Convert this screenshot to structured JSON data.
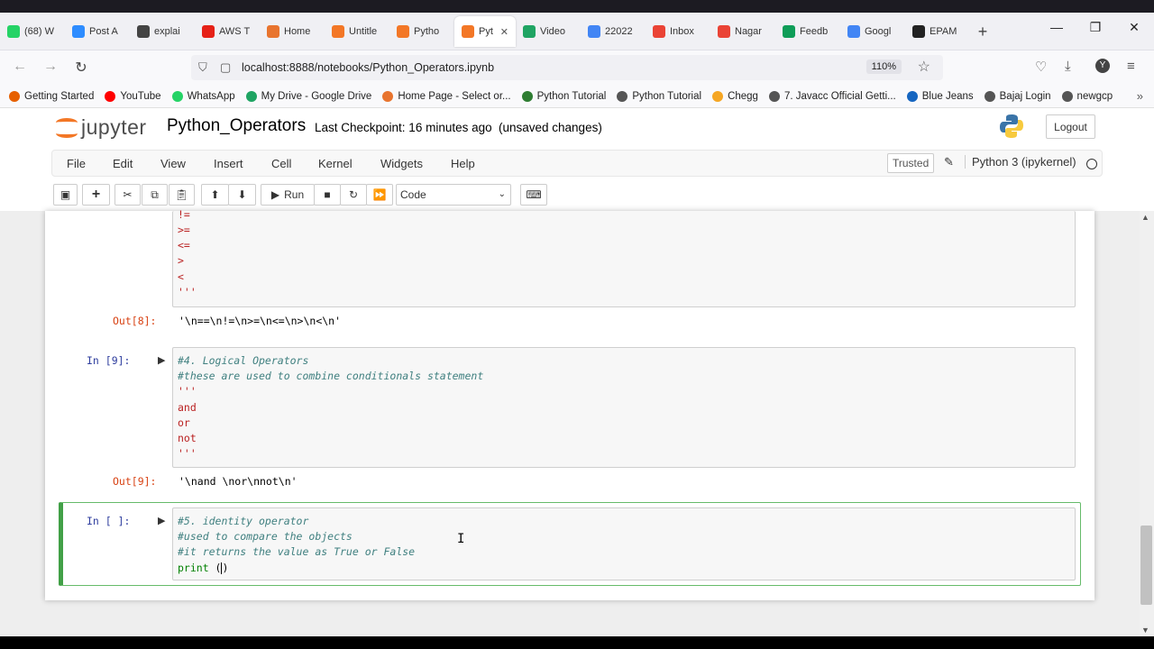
{
  "browser": {
    "tabs": [
      {
        "label": "(68) W",
        "color": "#25d366"
      },
      {
        "label": "Post A",
        "color": "#2d8cff"
      },
      {
        "label": "explai",
        "color": "#444444"
      },
      {
        "label": "AWS T",
        "color": "#e62117"
      },
      {
        "label": "Home",
        "color": "#e8742e"
      },
      {
        "label": "Untitle",
        "color": "#f37726"
      },
      {
        "label": "Pytho",
        "color": "#f37726"
      },
      {
        "label": "Pyt",
        "color": "#f37726",
        "active": true
      },
      {
        "label": "Video",
        "color": "#1fa463"
      },
      {
        "label": "22022",
        "color": "#4285f4"
      },
      {
        "label": "Inbox",
        "color": "#ea4335"
      },
      {
        "label": "Nagar",
        "color": "#ea4335"
      },
      {
        "label": "Feedb",
        "color": "#0f9d58"
      },
      {
        "label": "Googl",
        "color": "#4285f4"
      },
      {
        "label": "EPAM",
        "color": "#222222"
      }
    ],
    "url": "localhost:8888/notebooks/Python_Operators.ipynb",
    "zoom": "110%",
    "bookmarks": [
      {
        "label": "Getting Started",
        "color": "#e66000"
      },
      {
        "label": "YouTube",
        "color": "#ff0000"
      },
      {
        "label": "WhatsApp",
        "color": "#25d366"
      },
      {
        "label": "My Drive - Google Drive",
        "color": "#1fa463"
      },
      {
        "label": "Home Page - Select or...",
        "color": "#e8742e"
      },
      {
        "label": "Python Tutorial",
        "color": "#2e7d32"
      },
      {
        "label": "Python Tutorial",
        "color": "#555555"
      },
      {
        "label": "Chegg",
        "color": "#f5a623"
      },
      {
        "label": "7. Javacc Official Getti...",
        "color": "#555555"
      },
      {
        "label": "Blue Jeans",
        "color": "#1565c0"
      },
      {
        "label": "Bajaj Login",
        "color": "#555555"
      },
      {
        "label": "newgcp",
        "color": "#555555"
      }
    ]
  },
  "jupyter": {
    "logo_text": "jupyter",
    "notebook_title": "Python_Operators",
    "checkpoint": "Last Checkpoint: 16 minutes ago",
    "unsaved": "(unsaved changes)",
    "logout": "Logout",
    "menu": [
      "File",
      "Edit",
      "View",
      "Insert",
      "Cell",
      "Kernel",
      "Widgets",
      "Help"
    ],
    "trusted": "Trusted",
    "kernel": "Python 3 (ipykernel)",
    "toolbar": {
      "run": "Run",
      "cell_type": "Code"
    }
  },
  "cells": {
    "cell8": {
      "lines": [
        "!=",
        ">=",
        "<=",
        ">",
        "<",
        "'''"
      ],
      "out_prompt": "Out[8]:",
      "output": "'\\n==\\n!=\\n>=\\n<=\\n>\\n<\\n'"
    },
    "cell9": {
      "in_prompt": "In [9]:",
      "comment1": "#4. Logical Operators",
      "comment2": "#these are used to combine conditionals statement",
      "q1": "'''",
      "kw1": "and",
      "kw2": "or",
      "kw3": "not",
      "q2": "'''",
      "out_prompt": "Out[9]:",
      "output": "'\\nand \\nor\\nnot\\n'"
    },
    "cell10": {
      "in_prompt": "In [ ]:",
      "comment1": "#5. identity operator",
      "comment2": "#used to compare the objects",
      "comment3": "#it returns the value as True or False",
      "code_fn": "print",
      "code_open": " (",
      "code_close": ")"
    }
  }
}
